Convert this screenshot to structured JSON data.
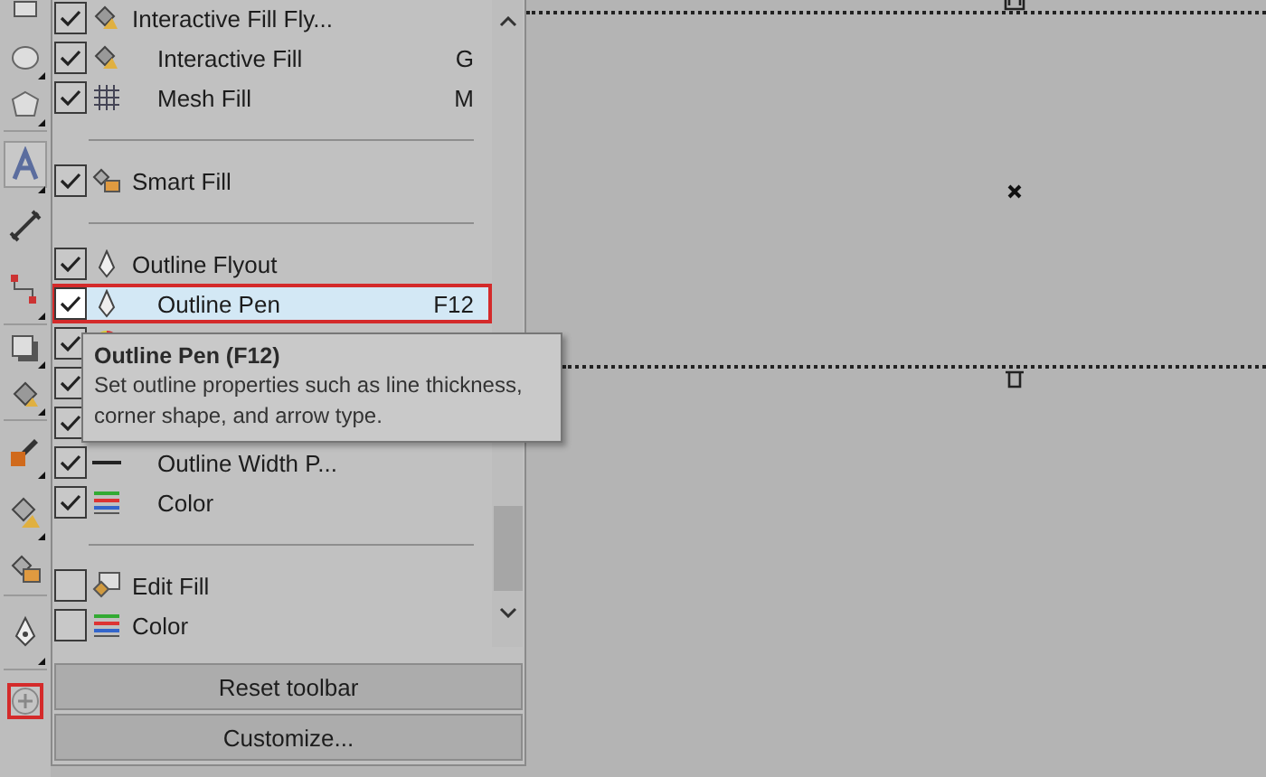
{
  "menu": {
    "entries": [
      {
        "kind": "item",
        "label": "Interactive Fill Fly...",
        "checked": true,
        "selected": false,
        "children": [
          {
            "kind": "item",
            "label": "Interactive Fill",
            "shortcut": "G",
            "checked": true,
            "selected": false
          },
          {
            "kind": "item",
            "label": "Mesh Fill",
            "shortcut": "M",
            "checked": true,
            "selected": false
          }
        ]
      },
      {
        "kind": "separator"
      },
      {
        "kind": "item",
        "label": "Smart Fill",
        "checked": true,
        "selected": false
      },
      {
        "kind": "separator"
      },
      {
        "kind": "item",
        "label": "Outline Flyout",
        "checked": true,
        "selected": false,
        "children": [
          {
            "kind": "item",
            "label": "Outline Pen",
            "shortcut": "F12",
            "checked": true,
            "selected": true
          },
          {
            "kind": "item",
            "checked": true,
            "selected": false
          },
          {
            "kind": "item",
            "checked": true,
            "selected": false
          },
          {
            "kind": "item",
            "checked": true,
            "selected": false
          },
          {
            "kind": "item",
            "label": "Outline Width P...",
            "checked": true,
            "selected": false
          },
          {
            "kind": "item",
            "label": "Color",
            "checked": true,
            "selected": false
          }
        ]
      },
      {
        "kind": "separator"
      },
      {
        "kind": "item",
        "label": "Edit Fill",
        "checked": false,
        "selected": false
      },
      {
        "kind": "item",
        "label": "Color",
        "checked": false,
        "selected": false
      }
    ],
    "buttons": [
      "Reset toolbar",
      "Customize..."
    ]
  },
  "tooltip": {
    "title": "Outline Pen (F12)",
    "text": "Set outline properties such as line thickness,\ncorner shape, and arrow type."
  }
}
